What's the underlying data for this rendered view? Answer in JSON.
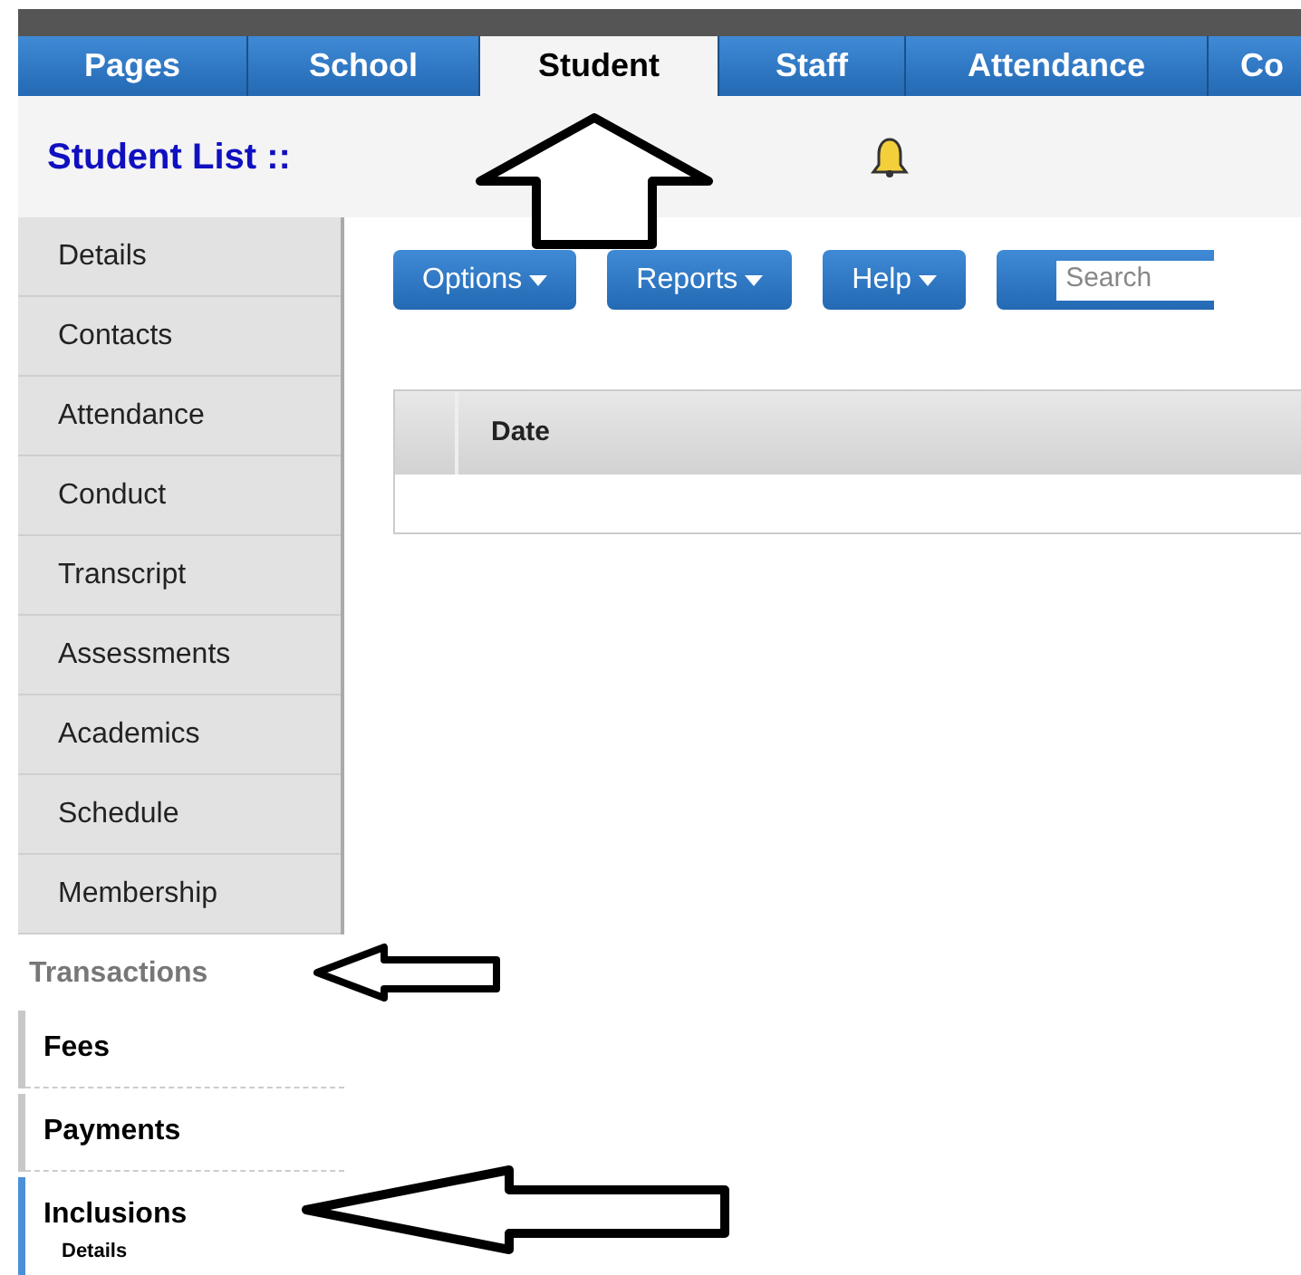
{
  "tabs": [
    {
      "label": "Pages",
      "selected": false
    },
    {
      "label": "School",
      "selected": false
    },
    {
      "label": "Student",
      "selected": true
    },
    {
      "label": "Staff",
      "selected": false
    },
    {
      "label": "Attendance",
      "selected": false
    },
    {
      "label": "Co",
      "selected": false
    }
  ],
  "header": {
    "title": "Student List ::"
  },
  "toolbar": {
    "buttons": [
      "Options",
      "Reports",
      "Help"
    ],
    "search": {
      "placeholder": "Search"
    }
  },
  "table": {
    "columns": [
      "",
      "Date"
    ]
  },
  "sidebar": {
    "items": [
      "Details",
      "Contacts",
      "Attendance",
      "Conduct",
      "Transcript",
      "Assessments",
      "Academics",
      "Schedule",
      "Membership"
    ],
    "section": {
      "title": "Transactions",
      "items": [
        {
          "label": "Fees",
          "selected": false
        },
        {
          "label": "Payments",
          "selected": false
        },
        {
          "label": "Inclusions",
          "selected": true,
          "sub": "Details"
        }
      ]
    }
  }
}
